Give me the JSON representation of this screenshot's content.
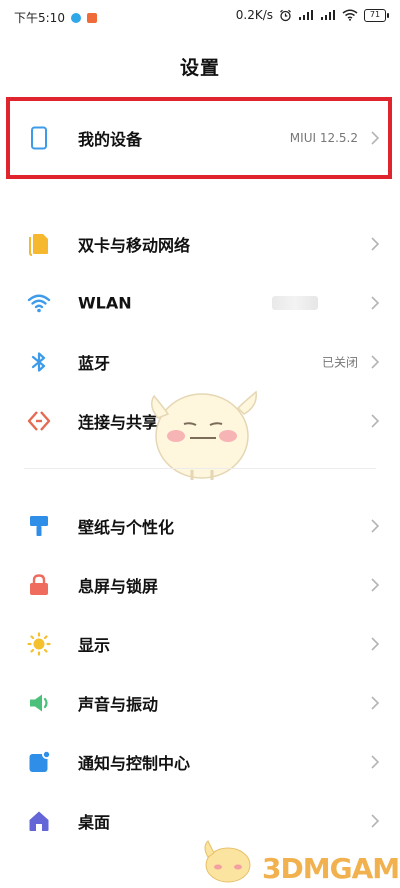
{
  "status_bar": {
    "time": "下午5:10",
    "net_speed": "0.2K/s",
    "battery": "71"
  },
  "page": {
    "title": "设置"
  },
  "device": {
    "label": "我的设备",
    "version": "MIUI 12.5.2"
  },
  "group1": [
    {
      "label": "双卡与移动网络",
      "icon": "sim-card-icon"
    },
    {
      "label": "WLAN",
      "icon": "wifi-icon"
    },
    {
      "label": "蓝牙",
      "icon": "bluetooth-icon",
      "value": "已关闭"
    },
    {
      "label": "连接与共享",
      "icon": "share-icon"
    }
  ],
  "group2": [
    {
      "label": "壁纸与个性化",
      "icon": "brush-icon"
    },
    {
      "label": "息屏与锁屏",
      "icon": "lock-icon"
    },
    {
      "label": "显示",
      "icon": "sun-icon"
    },
    {
      "label": "声音与振动",
      "icon": "speaker-icon"
    },
    {
      "label": "通知与控制中心",
      "icon": "notification-icon"
    },
    {
      "label": "桌面",
      "icon": "home-icon"
    }
  ],
  "watermark": "3DMGAME",
  "colors": {
    "highlight_border": "#e0242e",
    "sim": "#f5b82e",
    "wifi": "#3d9be9",
    "bluetooth": "#3d9be9",
    "share": "#e46a52",
    "brush": "#2f8ee8",
    "lock": "#ee6b5e",
    "sun": "#f5c02e",
    "speaker": "#4bc07a",
    "notification": "#2f8ee8",
    "home": "#6466d8"
  }
}
